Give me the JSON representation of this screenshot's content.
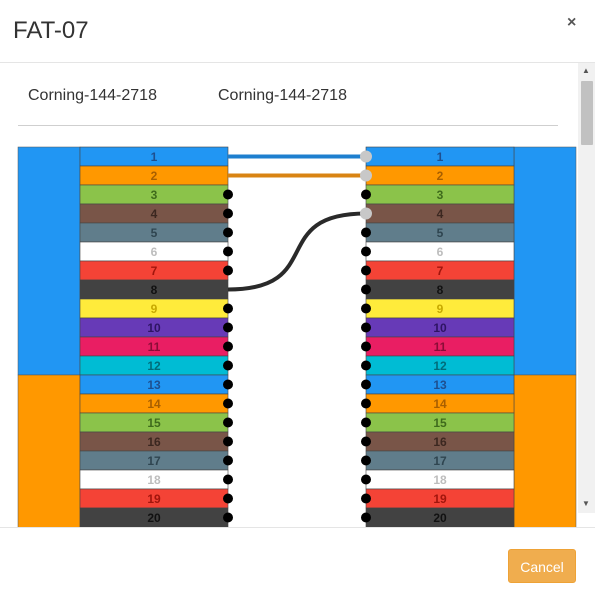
{
  "modal": {
    "title": "FAT-07",
    "close_label": "×"
  },
  "cables": {
    "left_name": "Corning-144-2718",
    "right_name": "Corning-144-2718"
  },
  "tube_colors": [
    "#2196f3",
    "#ff9800"
  ],
  "fibers": [
    {
      "number": "1",
      "bg": "#2196f3",
      "text": "#1e4f8f"
    },
    {
      "number": "2",
      "bg": "#ff9800",
      "text": "#a85f00"
    },
    {
      "number": "3",
      "bg": "#8bc34a",
      "text": "#3f6b1c"
    },
    {
      "number": "4",
      "bg": "#795548",
      "text": "#3b2720"
    },
    {
      "number": "5",
      "bg": "#607d8b",
      "text": "#2f4550"
    },
    {
      "number": "6",
      "bg": "#ffffff",
      "text": "#bdbdbd"
    },
    {
      "number": "7",
      "bg": "#f44336",
      "text": "#a1150c"
    },
    {
      "number": "8",
      "bg": "#424242",
      "text": "#111111"
    },
    {
      "number": "9",
      "bg": "#ffeb3b",
      "text": "#c7a900"
    },
    {
      "number": "10",
      "bg": "#673ab7",
      "text": "#2e1463"
    },
    {
      "number": "11",
      "bg": "#e91e63",
      "text": "#8a0d37"
    },
    {
      "number": "12",
      "bg": "#00bcd4",
      "text": "#006c7a"
    },
    {
      "number": "13",
      "bg": "#2196f3",
      "text": "#1e4f8f"
    },
    {
      "number": "14",
      "bg": "#ff9800",
      "text": "#a85f00"
    },
    {
      "number": "15",
      "bg": "#8bc34a",
      "text": "#3f6b1c"
    },
    {
      "number": "16",
      "bg": "#795548",
      "text": "#3b2720"
    },
    {
      "number": "17",
      "bg": "#607d8b",
      "text": "#2f4550"
    },
    {
      "number": "18",
      "bg": "#ffffff",
      "text": "#bdbdbd"
    },
    {
      "number": "19",
      "bg": "#f44336",
      "text": "#a1150c"
    },
    {
      "number": "20",
      "bg": "#424242",
      "text": "#111111"
    }
  ],
  "splices": [
    {
      "left_fiber": "1",
      "right_fiber": "1",
      "color": "#1e7fcf"
    },
    {
      "left_fiber": "2",
      "right_fiber": "2",
      "color": "#d98413"
    },
    {
      "left_fiber": "8",
      "right_fiber": "4",
      "color": "#2a2a2a"
    }
  ],
  "footer": {
    "cancel_label": "Cancel"
  }
}
